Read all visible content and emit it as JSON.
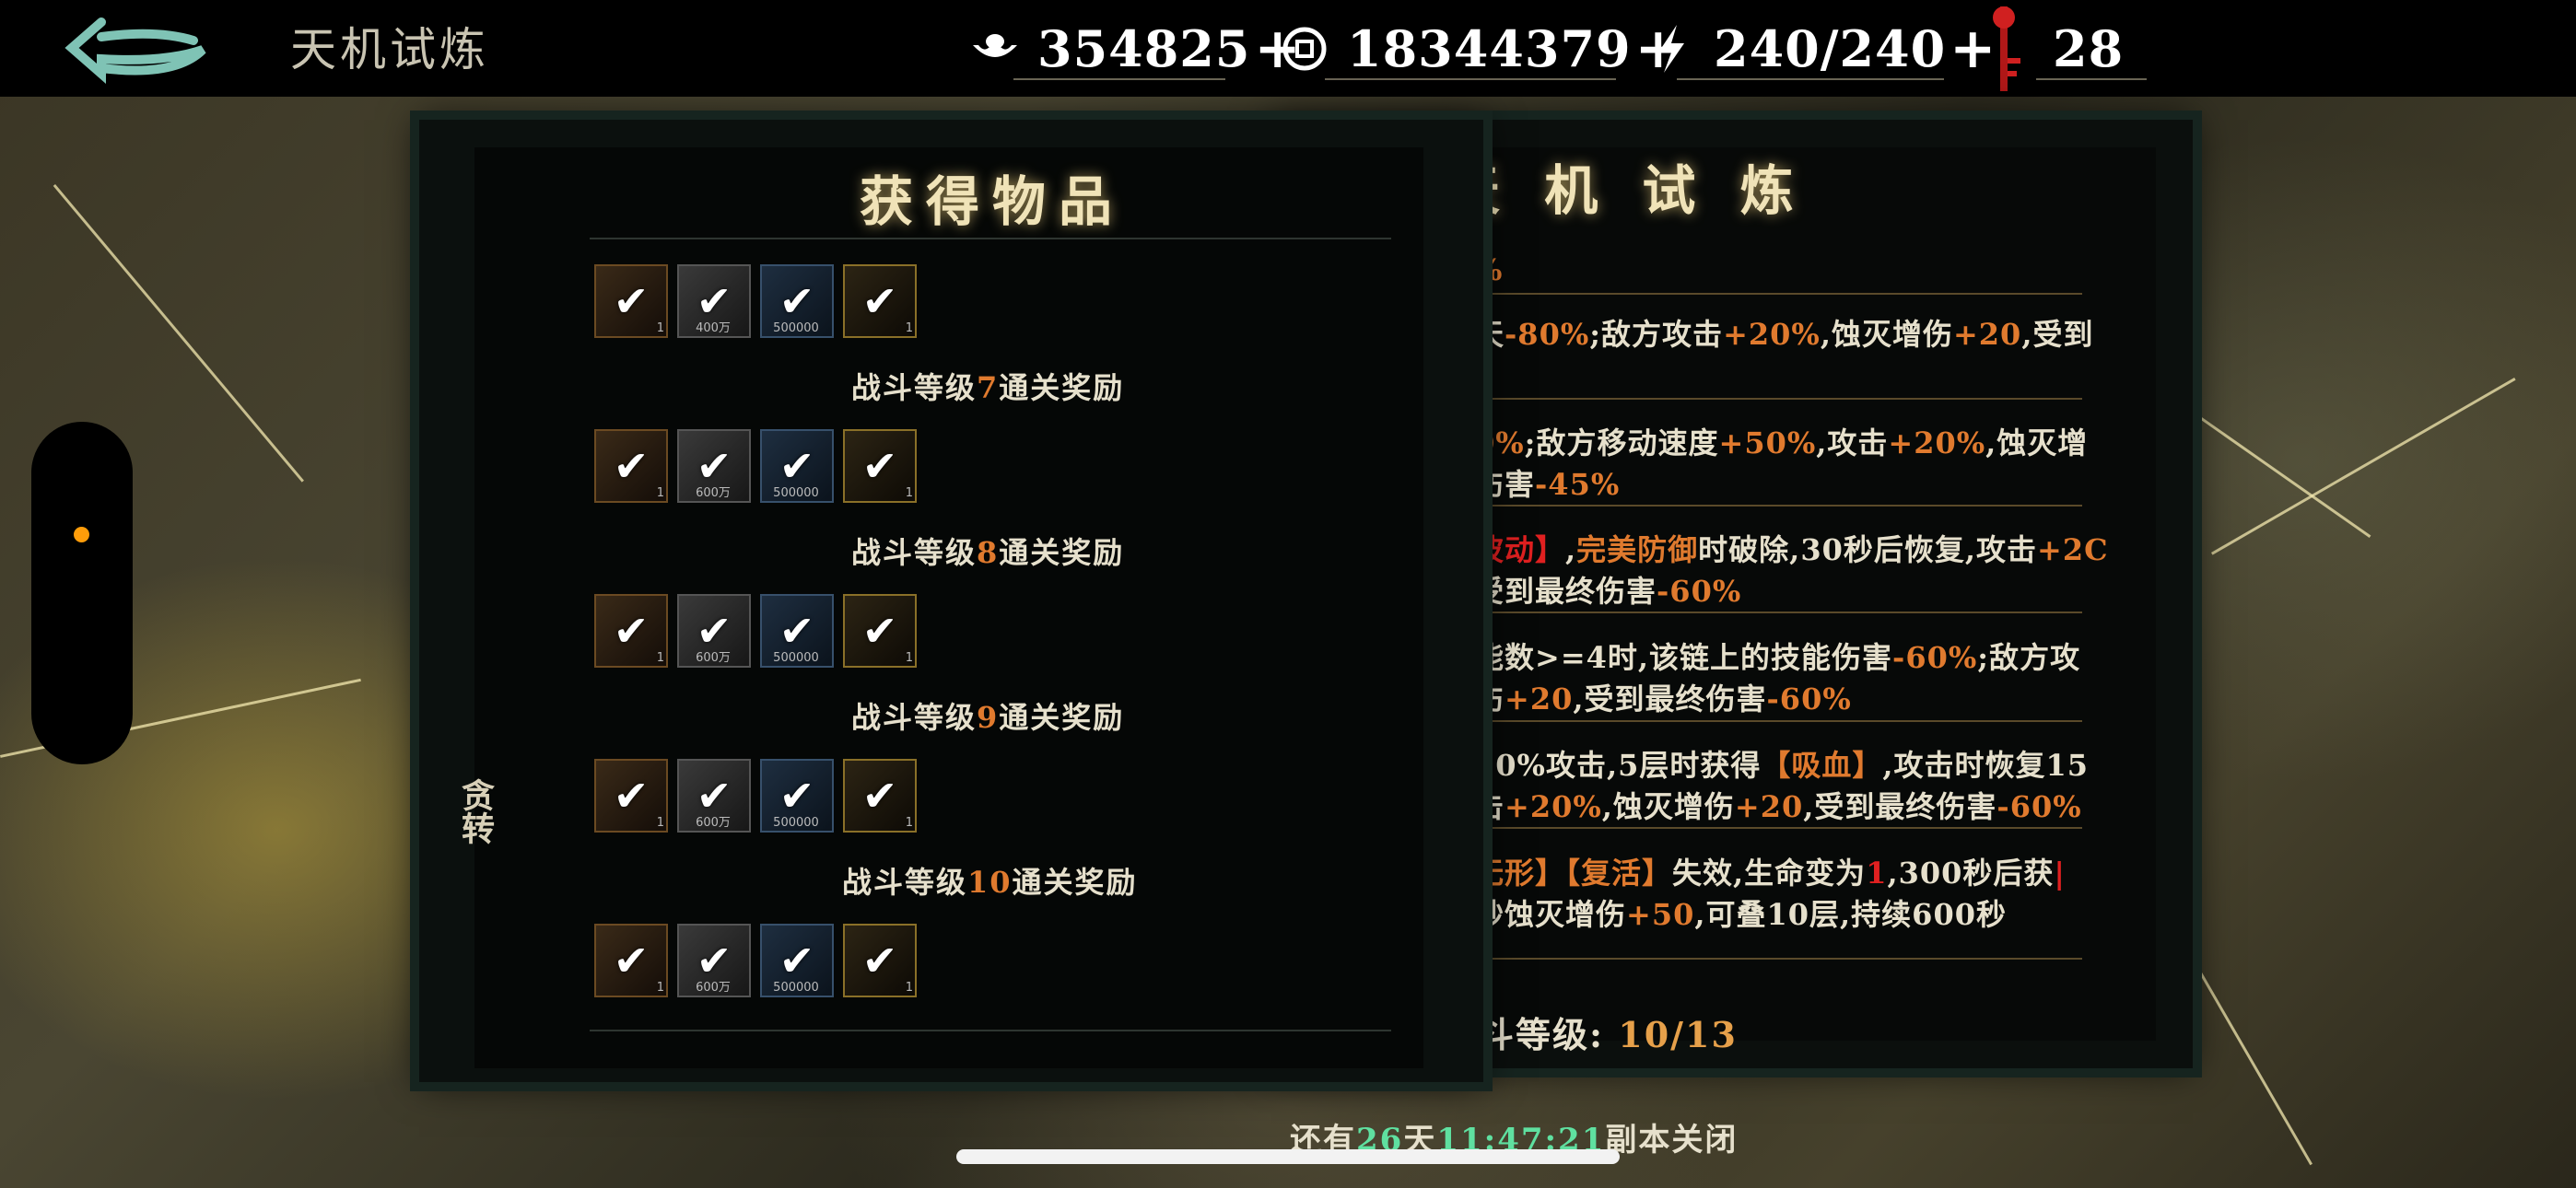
{
  "header": {
    "title": "天机试炼",
    "resources": [
      {
        "icon": "silver-ingot-icon",
        "value": "354825"
      },
      {
        "icon": "copper-coin-icon",
        "value": "18344379"
      },
      {
        "icon": "energy-bolt-icon",
        "value": "240/240"
      },
      {
        "icon": "red-key-icon",
        "value": "28"
      }
    ]
  },
  "rewards_panel": {
    "title": "获得物品",
    "groups": [
      {
        "label_prefix": "战斗等级",
        "level": "7",
        "label_suffix": "通关奖励"
      },
      {
        "label_prefix": "战斗等级",
        "level": "8",
        "label_suffix": "通关奖励"
      },
      {
        "label_prefix": "战斗等级",
        "level": "9",
        "label_suffix": "通关奖励"
      },
      {
        "label_prefix": "战斗等级",
        "level": "10",
        "label_suffix": "通关奖励"
      }
    ],
    "item_rows": [
      [
        "1",
        "400万",
        "500000",
        "1"
      ],
      [
        "1",
        "600万",
        "500000",
        "1"
      ],
      [
        "1",
        "600万",
        "500000",
        "1"
      ],
      [
        "1",
        "600万",
        "500000",
        "1"
      ],
      [
        "1",
        "600万",
        "500000",
        "1"
      ]
    ],
    "check_glyph": "✔"
  },
  "trial_panel": {
    "title": "天机试炼",
    "title_visible": "天 机 试 炼",
    "rules": [
      {
        "parts": [
          "%"
        ]
      },
      {
        "parts": [
          "天",
          "-80%",
          ";敌方攻击",
          "+20%",
          ",蚀灭增伤",
          "+20",
          ",受到"
        ]
      },
      {
        "parts": [
          "0%",
          ";敌方移动速度",
          "+50%",
          ",攻击",
          "+20%",
          ",蚀灭增"
        ]
      },
      {
        "parts": [
          "伤害",
          "-45%"
        ]
      },
      {
        "parts": [
          "波动】",
          ",",
          "完美防御",
          "时破除,30秒后恢复,攻击",
          "+2C"
        ]
      },
      {
        "parts": [
          "受到最终伤害",
          "-60%"
        ]
      },
      {
        "parts": [
          "能数>=4时,该链上的技能伤害",
          "-60%",
          ";敌方攻"
        ]
      },
      {
        "parts": [
          "伤",
          "+20",
          ",受到最终伤害",
          "-60%"
        ]
      },
      {
        "parts": [
          "20%攻击,5层时获得",
          "【吸血】",
          ",攻击时恢复15"
        ]
      },
      {
        "parts": [
          "击",
          "+20%",
          ",蚀灭增伤",
          "+20",
          ",受到最终伤害",
          "-60%"
        ]
      },
      {
        "parts": [
          "无形】",
          "【复活】",
          "失效,生命变为",
          "1",
          ",300秒后获",
          "|"
        ]
      },
      {
        "parts": [
          "秒蚀灭增伤",
          "+50",
          ",可叠10层,持续600秒"
        ]
      }
    ],
    "level_label": "斗等级:",
    "level_current": "10",
    "level_max": "/13"
  },
  "footer": {
    "prefix": "还有",
    "days": "26",
    "days_unit": "天",
    "time": "11:47:21",
    "suffix": "副本关闭"
  },
  "left_partial_text": "贪转"
}
